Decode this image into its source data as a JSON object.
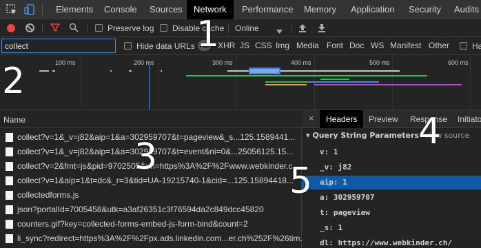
{
  "tabs": [
    {
      "label": "Elements"
    },
    {
      "label": "Console"
    },
    {
      "label": "Sources"
    },
    {
      "label": "Network"
    },
    {
      "label": "Performance"
    },
    {
      "label": "Memory"
    },
    {
      "label": "Application"
    },
    {
      "label": "Security"
    },
    {
      "label": "Audits"
    }
  ],
  "toolbar": {
    "preserve_log": "Preserve log",
    "disable_cache": "Disable cache",
    "throttle": "Online"
  },
  "filter": {
    "value": "collect",
    "hide_data_urls": "Hide data URLs",
    "types": [
      "All",
      "XHR",
      "JS",
      "CSS",
      "Img",
      "Media",
      "Font",
      "Doc",
      "WS",
      "Manifest",
      "Other"
    ],
    "trailing": "Ha"
  },
  "overview": {
    "ticks": [
      "100 ms",
      "200 ms",
      "300 ms",
      "400 ms",
      "500 ms",
      "600 ms"
    ]
  },
  "requests": {
    "header": "Name",
    "rows": [
      "collect?v=1&_v=j82&aip=1&a=302959707&t=pageview&_s...125.1589441...",
      "collect?v=1&_v=j82&aip=1&a=302959707&t=event&ni=0&...25056125.15...",
      "collect?v=2&fmt=js&pid=9702505&url=https%3A%2F%2Fwww.webkinder.c...",
      "collect?v=1&aip=1&t=dc&_r=3&tid=UA-19215740-1&cid=...125.15894418...",
      "collectedforms.js",
      "json?portalId=7005458&utk=a3af26351c3f76594da2c849dcc45820",
      "counters.gif?key=collected-forms-embed-js-form-bind&count=2",
      "li_sync?redirect=https%3A%2F%2Fpx.ads.linkedin.com...er.ch%252F%26tim..."
    ]
  },
  "details": {
    "close": "×",
    "tabs": [
      "Headers",
      "Preview",
      "Response",
      "Initiator"
    ],
    "section": "▾ Query String Parameters",
    "view_source": "view source",
    "params": [
      "v: 1",
      "_v: j82",
      "aip: 1",
      "a: 302959707",
      "t: pageview",
      "_s: 1",
      "dl: https://www.webkinder.ch/"
    ]
  },
  "overlay_numbers": [
    "1",
    "2",
    "3",
    "4",
    "5"
  ],
  "colors": {
    "selection": "#0e5aa7",
    "record": "#e8453c",
    "filter_active": "#e8453c",
    "focus": "#3f8fdc"
  }
}
